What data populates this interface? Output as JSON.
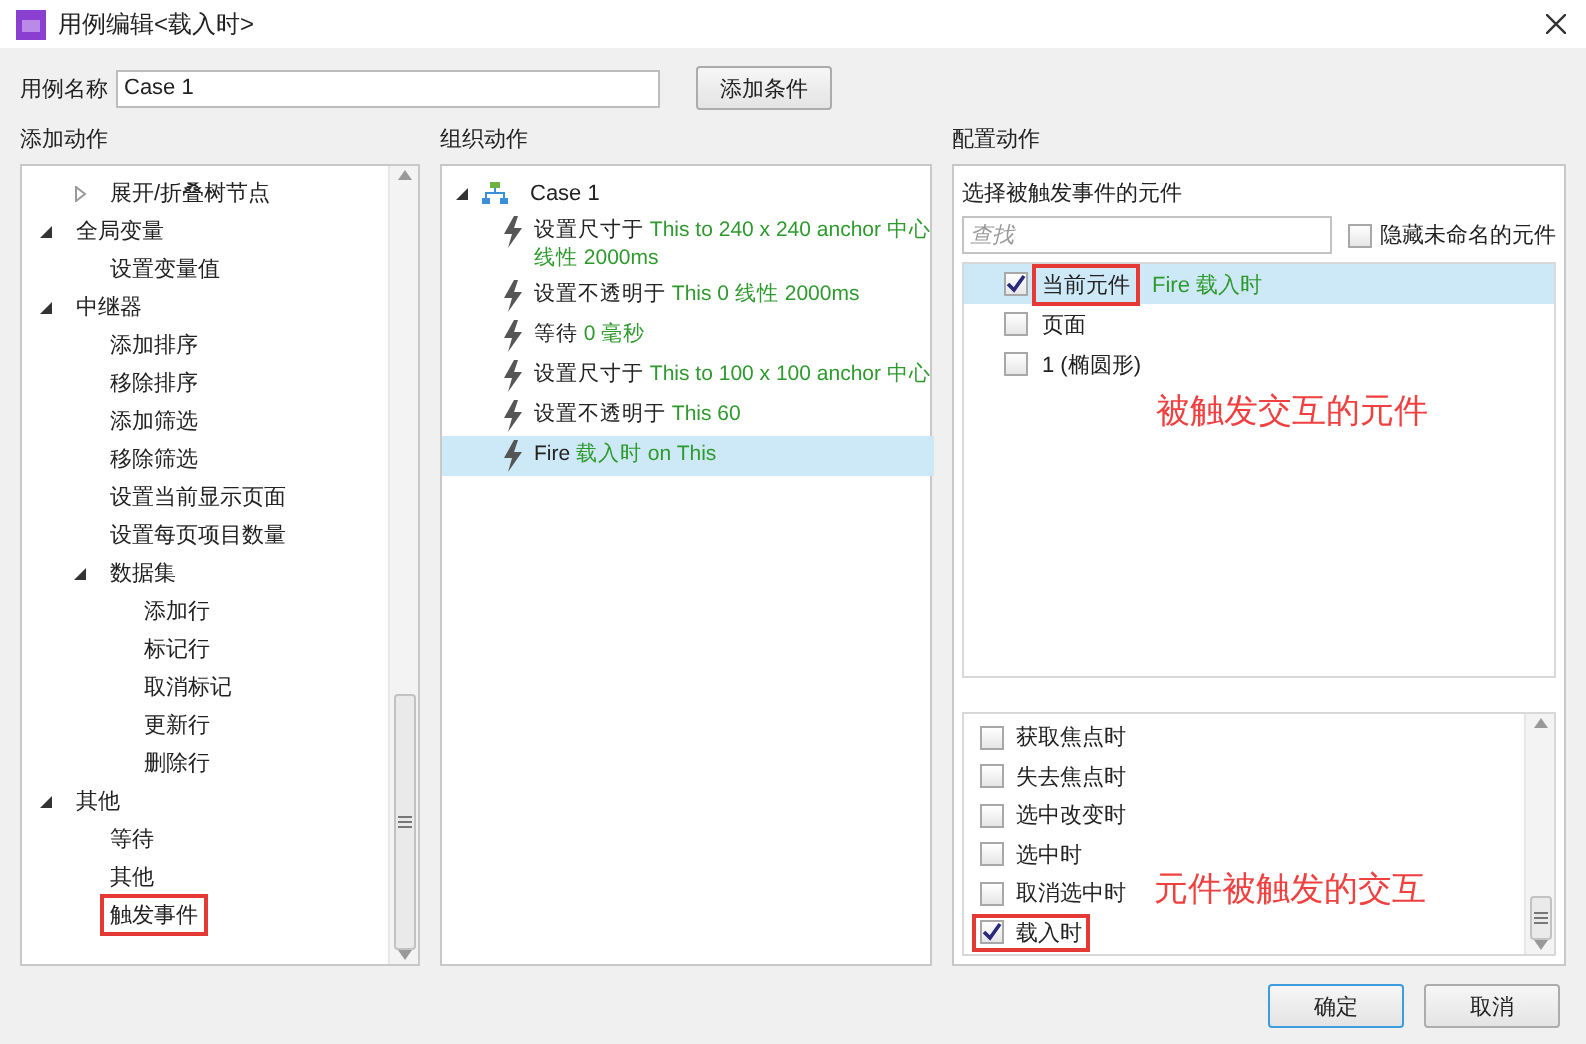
{
  "window": {
    "title": "用例编辑<载入时>"
  },
  "case_name": {
    "label": "用例名称",
    "value": "Case 1",
    "add_condition_button": "添加条件"
  },
  "add_actions": {
    "title": "添加动作",
    "tree": [
      {
        "children": [
          {
            "label": "展开/折叠树节点",
            "expanded": false
          }
        ]
      },
      {
        "label": "全局变量",
        "expanded": true,
        "children": [
          {
            "label": "设置变量值"
          }
        ]
      },
      {
        "label": "中继器",
        "expanded": true,
        "children": [
          {
            "label": "添加排序"
          },
          {
            "label": "移除排序"
          },
          {
            "label": "添加筛选"
          },
          {
            "label": "移除筛选"
          },
          {
            "label": "设置当前显示页面"
          },
          {
            "label": "设置每页项目数量"
          },
          {
            "label": "数据集",
            "expanded": true,
            "children": [
              {
                "label": "添加行"
              },
              {
                "label": "标记行"
              },
              {
                "label": "取消标记"
              },
              {
                "label": "更新行"
              },
              {
                "label": "删除行"
              }
            ]
          }
        ]
      },
      {
        "label": "其他",
        "expanded": true,
        "children": [
          {
            "label": "等待"
          },
          {
            "label": "其他"
          },
          {
            "label": "触发事件",
            "annotated": true
          }
        ]
      }
    ]
  },
  "organize_actions": {
    "title": "组织动作",
    "case": "Case 1",
    "actions": [
      {
        "label": "设置尺寸于",
        "detail": "This to 240 x 240 anchor 中心线性 2000ms",
        "selected": false
      },
      {
        "label": "设置不透明于",
        "detail": "This 0 线性 2000ms",
        "selected": false
      },
      {
        "label": "等待",
        "detail": "0 毫秒",
        "selected": false
      },
      {
        "label": "设置尺寸于",
        "detail": "This to 100 x 100 anchor 中心",
        "selected": false
      },
      {
        "label": "设置不透明于",
        "detail": "This 60",
        "selected": false
      },
      {
        "label": "Fire",
        "detail": "载入时 on This",
        "selected": true
      }
    ]
  },
  "configure_actions": {
    "title": "配置动作",
    "subtitle": "选择被触发事件的元件",
    "search": {
      "placeholder": "查找"
    },
    "hide_unnamed": {
      "label": "隐藏未命名的元件",
      "checked": false
    },
    "elements": [
      {
        "label": "当前元件",
        "detail": "Fire 载入时",
        "checked": true,
        "selected": true,
        "annotated": true
      },
      {
        "label": "页面",
        "checked": false,
        "selected": false,
        "annotated": false
      },
      {
        "label": "1 (椭圆形)",
        "checked": false,
        "selected": false,
        "annotated": false
      }
    ],
    "elements_annotation": "被触发交互的元件",
    "events": [
      {
        "label": "获取焦点时",
        "checked": false,
        "annotated": false
      },
      {
        "label": "失去焦点时",
        "checked": false,
        "annotated": false
      },
      {
        "label": "选中改变时",
        "checked": false,
        "annotated": false
      },
      {
        "label": "选中时",
        "checked": false,
        "annotated": false
      },
      {
        "label": "取消选中时",
        "checked": false,
        "annotated": false
      },
      {
        "label": "载入时",
        "checked": true,
        "annotated": true
      }
    ],
    "events_annotation": "元件被触发的交互"
  },
  "buttons": [
    {
      "label": "确定",
      "default": true
    },
    {
      "label": "取消",
      "default": false
    }
  ]
}
